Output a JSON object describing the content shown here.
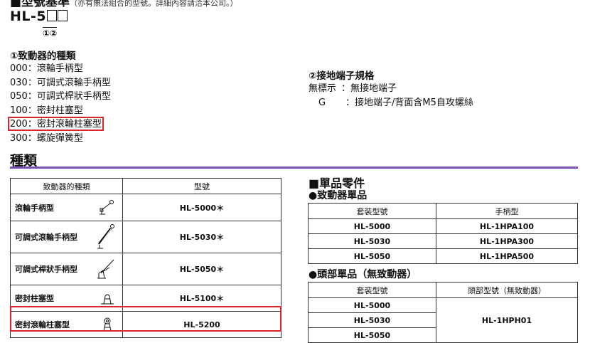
{
  "heading": {
    "title": "■型號基準",
    "note": "（亦有無法組合的型號。詳細內容請洽本公司。）"
  },
  "model_code": {
    "prefix": "HL-5",
    "marks": "①②"
  },
  "actuator_section": {
    "title": "①致動器的種類",
    "items": [
      "000：滾輪手柄型",
      "030：可調式滾輪手柄型",
      "050：可調式桿狀手柄型",
      "100：密封柱塞型",
      "200：密封滾輪柱塞型",
      "300：螺旋彈簧型"
    ]
  },
  "terminal_section": {
    "title": "②接地端子規格",
    "items": [
      {
        "code": "無標示",
        "desc": "：無接地端子"
      },
      {
        "code": "G",
        "desc": "：接地端子/背面含M5自攻螺絲"
      }
    ]
  },
  "types_section": {
    "title": "種類",
    "headers": [
      "致動器的種類",
      "型號"
    ],
    "rows": [
      {
        "name": "滾輪手柄型",
        "model": "HL-5000＊",
        "icon": "roller-lever-icon"
      },
      {
        "name": "可調式滾輪手柄型",
        "model": "HL-5030＊",
        "icon": "adjustable-roller-lever-icon"
      },
      {
        "name": "可調式桿狀手柄型",
        "model": "HL-5050＊",
        "icon": "adjustable-rod-lever-icon"
      },
      {
        "name": "密封柱塞型",
        "model": "HL-5100＊",
        "icon": "sealed-plunger-icon"
      },
      {
        "name": "密封滾輪柱塞型",
        "model": "HL-5200",
        "icon": "sealed-roller-plunger-icon"
      }
    ]
  },
  "parts_section": {
    "title": "■單品零件",
    "actuator_unit": {
      "title": "●致動器單品",
      "headers": [
        "套裝型號",
        "手柄型"
      ],
      "rows": [
        [
          "HL-5000",
          "HL-1HPA100"
        ],
        [
          "HL-5030",
          "HL-1HPA300"
        ],
        [
          "HL-5050",
          "HL-1HPA500"
        ]
      ]
    },
    "head_unit": {
      "title": "●頭部單品（無致動器）",
      "headers": [
        "套裝型號",
        "頭部型號（無致動器）"
      ],
      "rows": [
        "HL-5000",
        "HL-5030",
        "HL-5050"
      ],
      "merged_value": "HL-1HPH01"
    }
  },
  "colors": {
    "accent": "#7c4fb5",
    "highlight": "#d9262c"
  }
}
